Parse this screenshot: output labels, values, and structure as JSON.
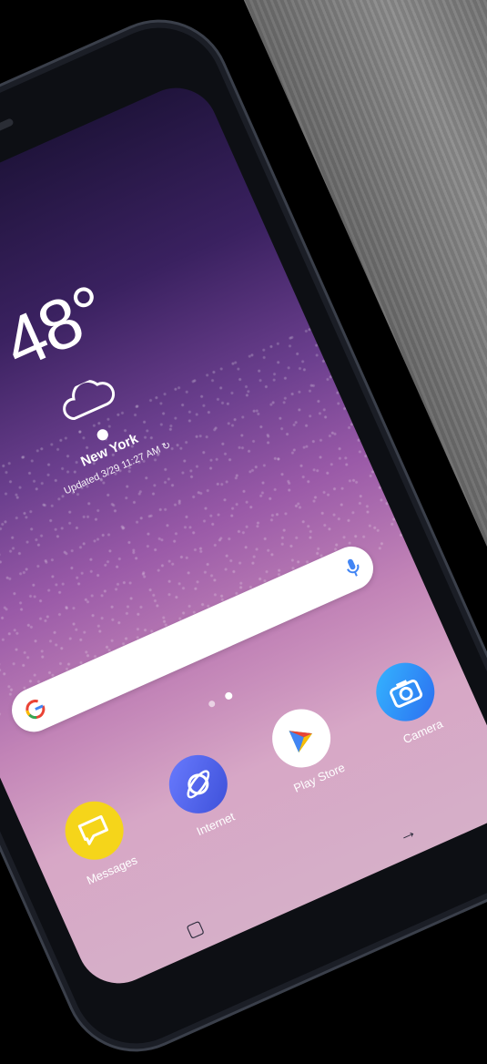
{
  "status_bar": {
    "signal_icon": "signal-icon"
  },
  "weather": {
    "temperature": "48°",
    "icon": "cloud-icon",
    "location_icon": "location-pin-icon",
    "city": "New York",
    "updated": "Updated 3/29 11:27 AM",
    "refresh_icon": "refresh-icon"
  },
  "search_bar": {
    "google_icon": "google-g-icon",
    "mic_icon": "mic-icon"
  },
  "page_indicator": {
    "pages": 2,
    "home_icon": "home-dot-icon"
  },
  "dock": {
    "apps": [
      {
        "label": "Messages",
        "icon": "messages-icon",
        "color": "#f5d51a"
      },
      {
        "label": "Internet",
        "icon": "internet-planet-icon",
        "color": "#4b5ee6"
      },
      {
        "label": "Play Store",
        "icon": "play-store-icon",
        "color": "#ffffff"
      },
      {
        "label": "Camera",
        "icon": "camera-icon",
        "color": "#2f8ef6"
      }
    ]
  },
  "nav_bar": {
    "recents_icon": "recents-icon",
    "back_icon": "back-arrow-icon"
  }
}
